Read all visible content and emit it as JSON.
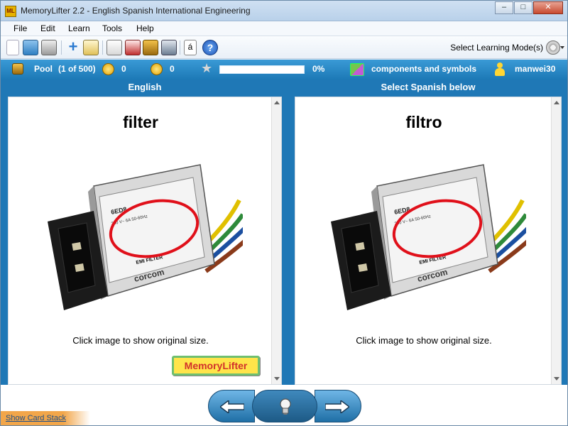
{
  "window": {
    "title": "MemoryLifter 2.2 - English Spanish International Engineering",
    "icon_text": "ML",
    "minimize": "–",
    "maximize": "□",
    "close": "✕"
  },
  "menu": [
    "File",
    "Edit",
    "Learn",
    "Tools",
    "Help"
  ],
  "toolbar": {
    "icons": [
      "new-document-icon",
      "open-folder-icon",
      "print-icon",
      "add-icon",
      "edit-icon",
      "slideshow-icon",
      "statistics-icon",
      "card-stack-icon",
      "tools-icon",
      "special-character-icon",
      "help-icon"
    ],
    "special_char": "á",
    "help_char": "?",
    "learning_mode_label": "Select Learning Mode(s)"
  },
  "status": {
    "pool_label": "Pool",
    "pool_count": "(1 of 500)",
    "wrong_count": "0",
    "right_count": "0",
    "progress_text": "0%",
    "progress_fraction": 0.0,
    "chapter": "components and symbols",
    "user": "manwei30"
  },
  "columns": {
    "left_header": "English",
    "right_header": "Select Spanish below"
  },
  "question": {
    "word": "filter",
    "caption": "Click image to show original size."
  },
  "answer": {
    "word": "filtro",
    "caption": "Click image to show original size."
  },
  "image_labels": {
    "brand": "corcom",
    "model": "6ED8",
    "part": "EMI FILTER",
    "rating": "250 V~ 6A 50-60Hz"
  },
  "logo_text": "MemoryLifter",
  "footer": {
    "show_card_stack": "Show Card Stack"
  },
  "colors": {
    "status_blue": "#1c79b6",
    "content_blue": "#1f78b6",
    "highlight_red": "#e0101a",
    "logo_yellow": "#ffe44a",
    "logo_red": "#d2312b"
  }
}
